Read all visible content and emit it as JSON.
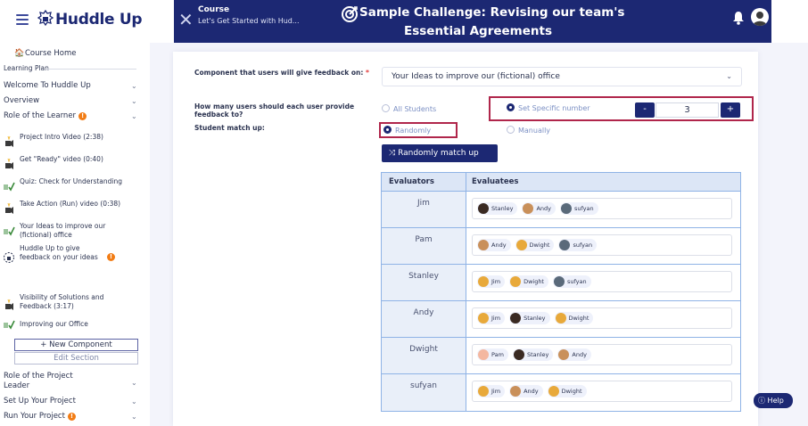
{
  "header": {
    "brand": "Huddle Up",
    "course_label": "Course",
    "course_subtitle": "Let's Get Started with Hud...",
    "title_line1": "Sample Challenge: Revising our team's",
    "title_line2": "Essential Agreements"
  },
  "sidebar": {
    "home": "Course Home",
    "plan": "Learning Plan",
    "sections": [
      {
        "label": "Welcome To Huddle Up"
      },
      {
        "label": "Overview"
      },
      {
        "label": "Role of the Learner"
      }
    ],
    "items": [
      {
        "label": "Project Intro Video (2:38)",
        "icon": "video-icon"
      },
      {
        "label": "Get \"Ready\" video (0:40)",
        "icon": "video-icon"
      },
      {
        "label": "Quiz: Check for Understanding",
        "icon": "quiz-icon"
      },
      {
        "label": "Take Action (Run) video (0:38)",
        "icon": "video-icon"
      },
      {
        "label": "Your Ideas to improve our (fictional) office",
        "icon": "quiz-icon"
      },
      {
        "label": "Huddle Up to give feedback on your ideas",
        "icon": "huddle-icon"
      },
      {
        "label": "Visibility of Solutions and Feedback (3:17)",
        "icon": "video-icon"
      },
      {
        "label": "Improving our Office",
        "icon": "quiz-icon"
      }
    ],
    "new_component": "+ New Component",
    "edit_section": "Edit Section",
    "sections_after": [
      {
        "label": "Role of the Project Leader"
      },
      {
        "label": "Set Up Your Project"
      },
      {
        "label": "Run Your Project"
      }
    ]
  },
  "form": {
    "component_label": "Component that users will give feedback on:",
    "required_mark": "*",
    "component_value": "Your Ideas to improve our (fictional) office",
    "users_label": "How many users should each user provide feedback to?",
    "opt_all": "All Students",
    "opt_specific": "Set Specific number",
    "count": "3",
    "minus": "-",
    "plus": "+",
    "match_label": "Student match up:",
    "opt_random": "Randomly",
    "opt_manual": "Manually",
    "random_button": "Randomly match up"
  },
  "table": {
    "headers": [
      "Evaluators",
      "Evaluatees"
    ],
    "rows": [
      {
        "evaluator": "Jim",
        "evaluatees": [
          "Stanley",
          "Andy",
          "sufyan"
        ]
      },
      {
        "evaluator": "Pam",
        "evaluatees": [
          "Andy",
          "Dwight",
          "sufyan"
        ]
      },
      {
        "evaluator": "Stanley",
        "evaluatees": [
          "Jim",
          "Dwight",
          "sufyan"
        ]
      },
      {
        "evaluator": "Andy",
        "evaluatees": [
          "Jim",
          "Stanley",
          "Dwight"
        ]
      },
      {
        "evaluator": "Dwight",
        "evaluatees": [
          "Pam",
          "Stanley",
          "Andy"
        ]
      },
      {
        "evaluator": "sufyan",
        "evaluatees": [
          "Jim",
          "Andy",
          "Dwight"
        ]
      }
    ]
  },
  "avatars": {
    "Jim": "#e8a93a",
    "Pam": "#f4b7a0",
    "Stanley": "#3a2a22",
    "Andy": "#c9905a",
    "Dwight": "#e8a93a",
    "sufyan": "#5a6a7a"
  },
  "help": "Help",
  "colors": {
    "navy": "#1c2873",
    "highlight": "#b0264b",
    "warning": "#f27c14"
  }
}
